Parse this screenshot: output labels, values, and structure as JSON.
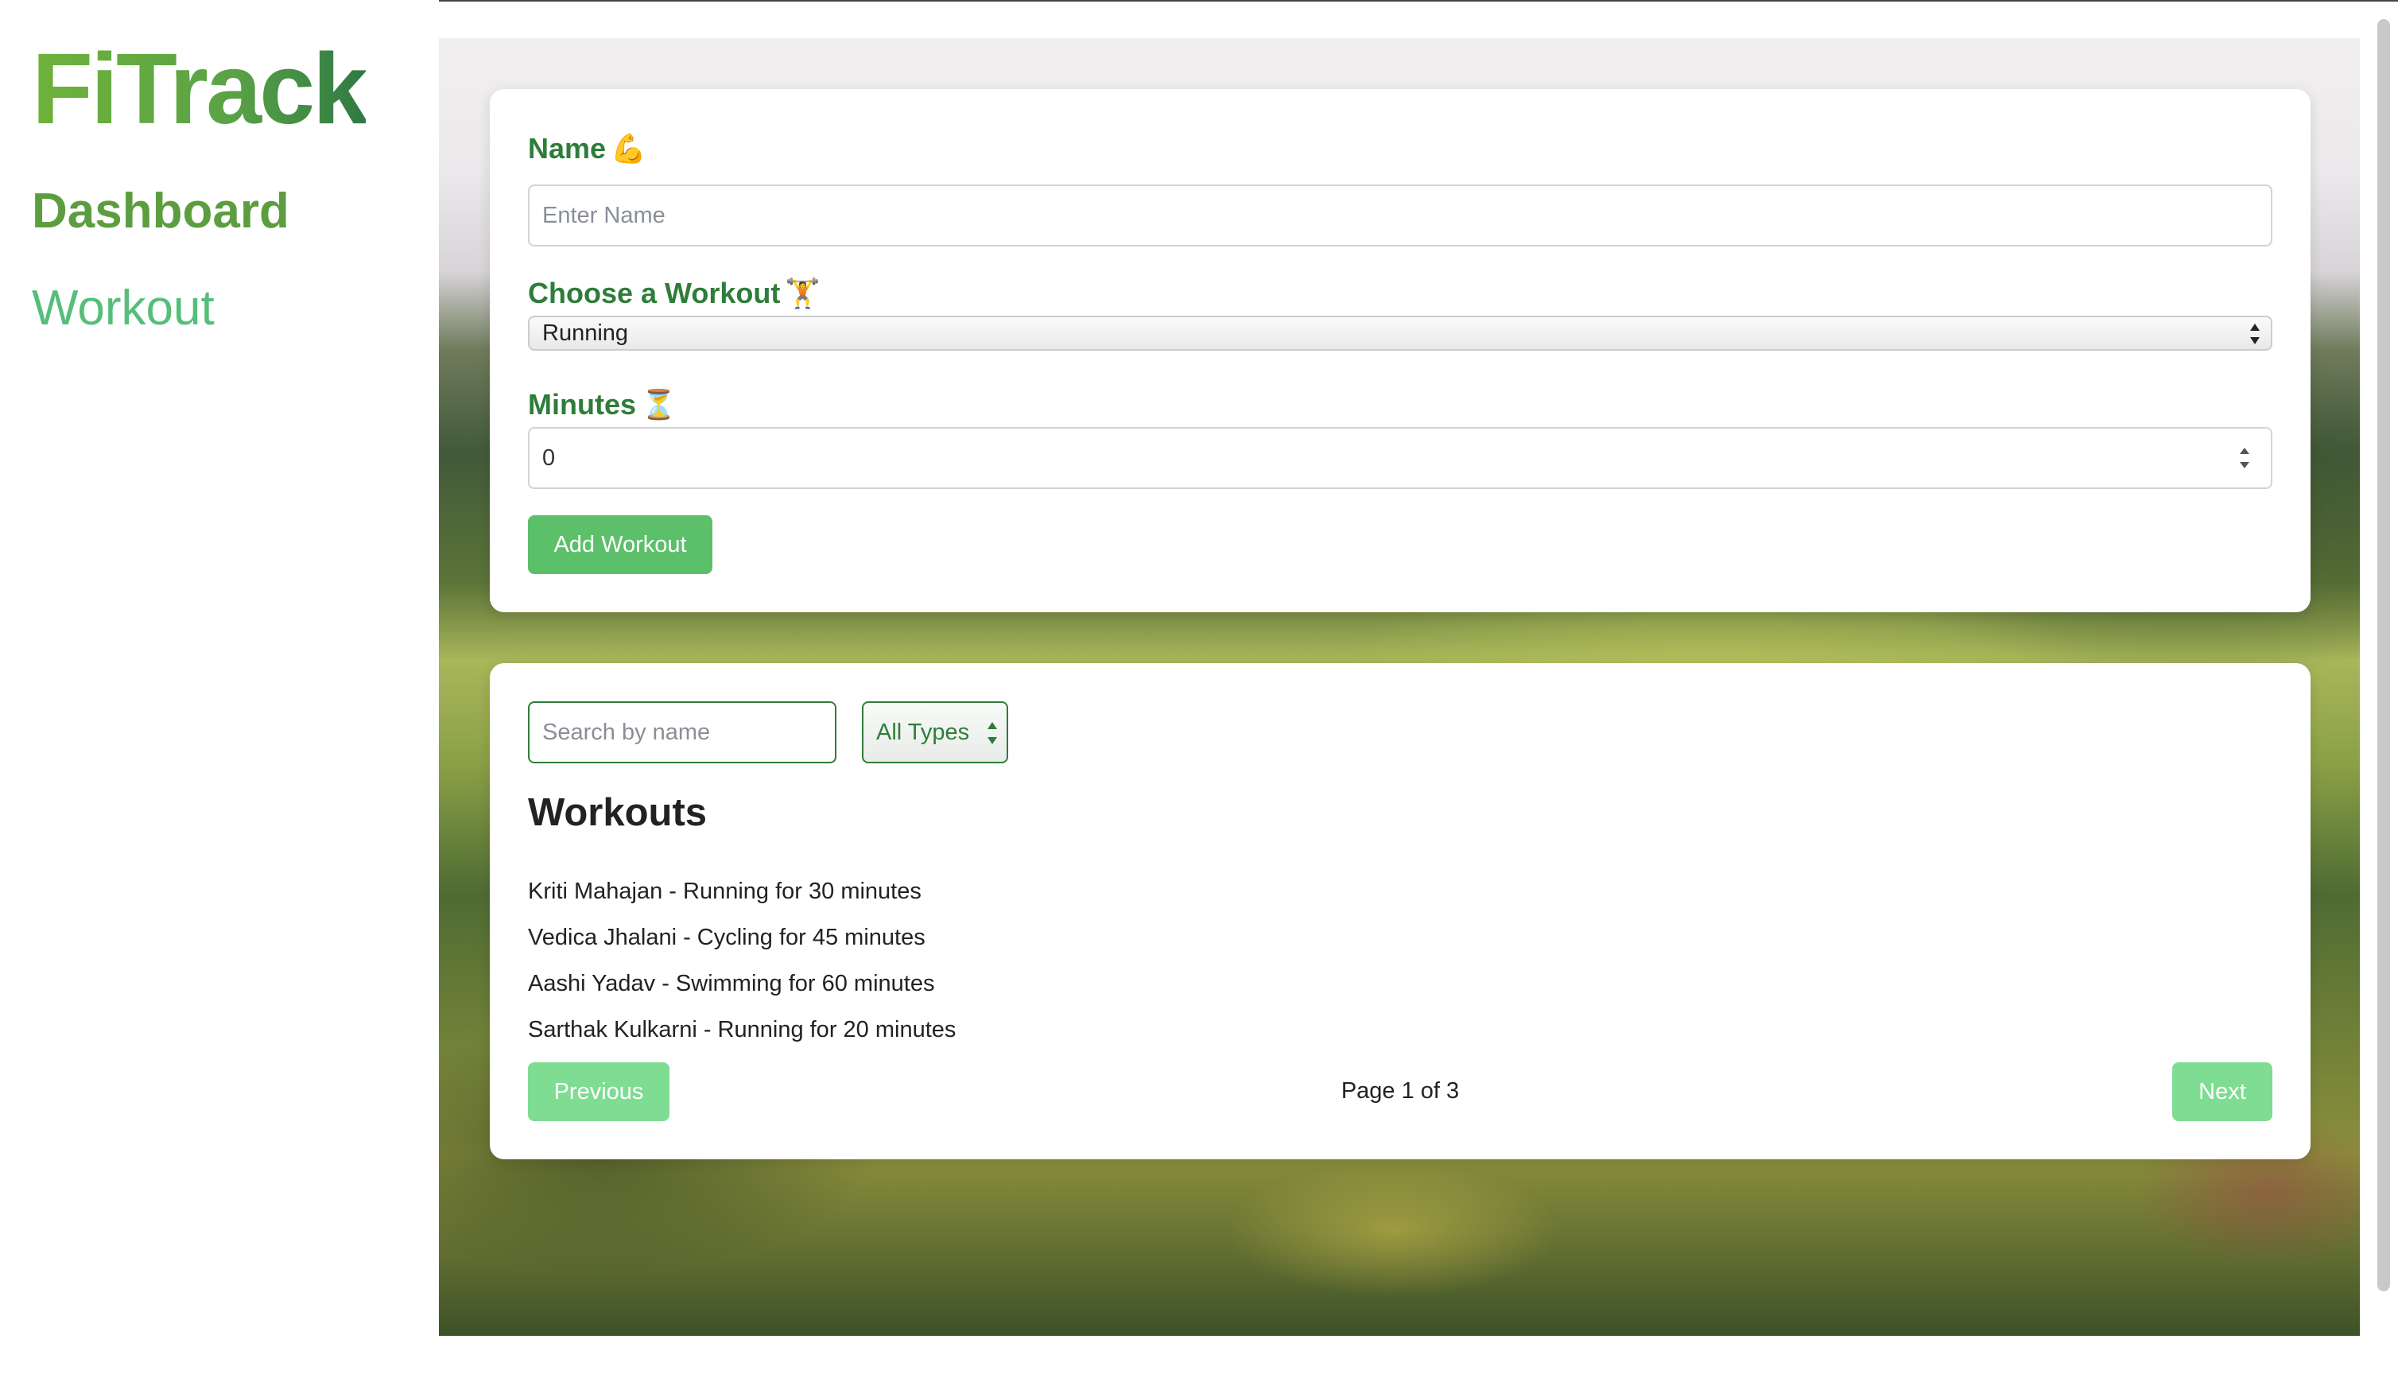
{
  "app": {
    "brand": "FiTrack",
    "nav": [
      {
        "label": "Dashboard"
      },
      {
        "label": "Workout"
      }
    ]
  },
  "form": {
    "name_label": "Name",
    "name_emoji": "💪",
    "name_placeholder": "Enter Name",
    "name_value": "",
    "workout_label": "Choose a Workout",
    "workout_emoji": "🏋️",
    "workout_selected": "Running",
    "minutes_label": "Minutes",
    "minutes_emoji": "⏳",
    "minutes_value": "0",
    "add_button": "Add Workout"
  },
  "list": {
    "search_placeholder": "Search by name",
    "type_filter_selected": "All Types",
    "heading": "Workouts",
    "items": [
      "Kriti Mahajan - Running for 30 minutes",
      "Vedica Jhalani - Cycling for 45 minutes",
      "Aashi Yadav - Swimming for 60 minutes",
      "Sarthak Kulkarni - Running for 20 minutes"
    ],
    "prev_button": "Previous",
    "next_button": "Next",
    "page_indicator": "Page 1 of 3"
  },
  "colors": {
    "primary_green": "#2e7d3a",
    "button_green": "#5cc06a",
    "button_light_green": "#7fdc93",
    "nav_active": "#5c9e3f",
    "nav_link": "#56be7a"
  }
}
